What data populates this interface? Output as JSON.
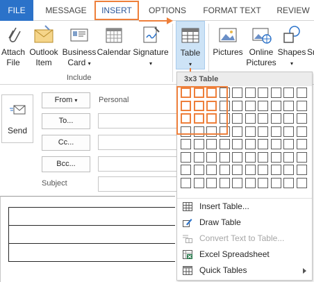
{
  "ribbon_tabs": [
    "FILE",
    "MESSAGE",
    "INSERT",
    "OPTIONS",
    "FORMAT TEXT",
    "REVIEW"
  ],
  "ribbon": {
    "attach_file": "Attach\nFile",
    "outlook_item": "Outlook\nItem",
    "business_card": "Business\nCard",
    "calendar": "Calendar",
    "signature": "Signature",
    "include_group": "Include",
    "table": "Table",
    "pictures": "Pictures",
    "online_pictures": "Online\nPictures",
    "shapes": "Shapes",
    "smartart": "Sn"
  },
  "compose": {
    "send": "Send",
    "from": "From",
    "from_value": "Personal",
    "to": "To...",
    "cc": "Cc...",
    "bcc": "Bcc...",
    "subject": "Subject"
  },
  "table_menu": {
    "title": "3x3 Table",
    "grid_cols": 10,
    "grid_rows": 8,
    "selected_cols": 3,
    "selected_rows": 3,
    "items": [
      {
        "label": "Insert Table...",
        "disabled": false
      },
      {
        "label": "Draw Table",
        "disabled": false
      },
      {
        "label": "Convert Text to Table...",
        "disabled": true
      },
      {
        "label": "Excel Spreadsheet",
        "disabled": false
      },
      {
        "label": "Quick Tables",
        "disabled": false
      }
    ]
  },
  "colors": {
    "accent": "#ee7f3a",
    "file_tab": "#2b72c9",
    "insert_tab_text": "#2b579a",
    "active_button": "#cde3f6"
  }
}
